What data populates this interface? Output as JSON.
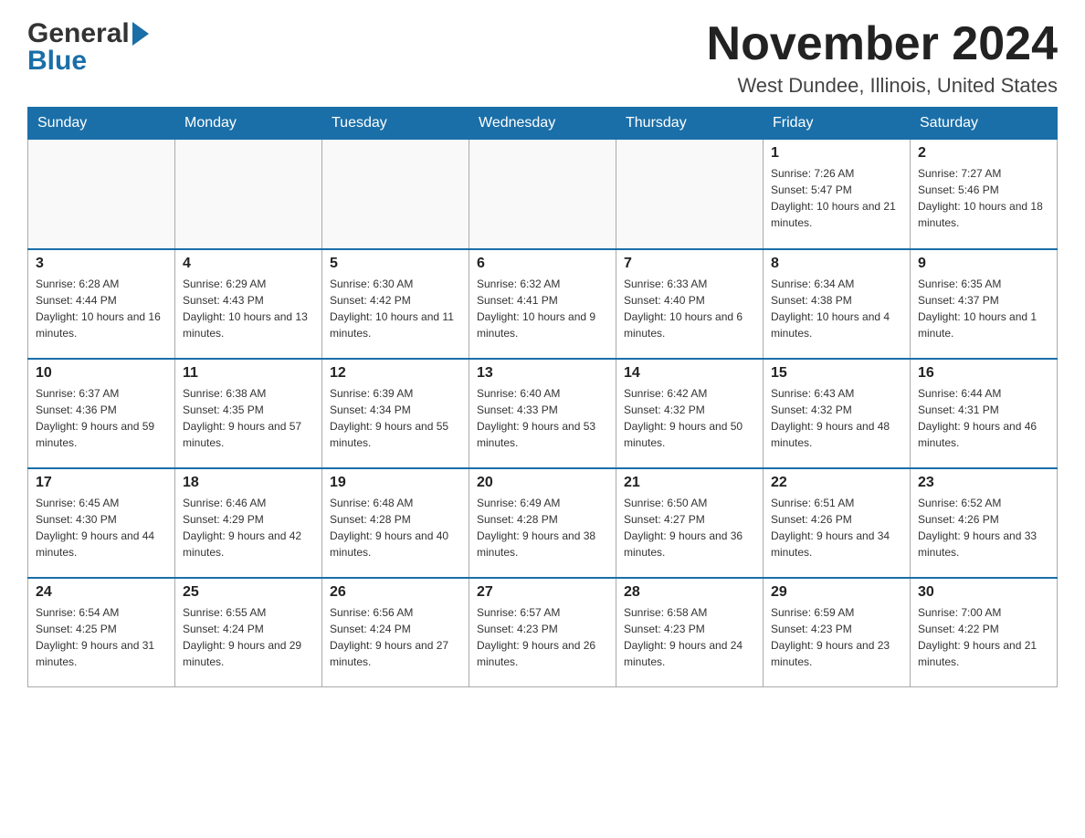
{
  "header": {
    "logo_general": "General",
    "logo_blue": "Blue",
    "month_title": "November 2024",
    "location": "West Dundee, Illinois, United States"
  },
  "weekdays": [
    "Sunday",
    "Monday",
    "Tuesday",
    "Wednesday",
    "Thursday",
    "Friday",
    "Saturday"
  ],
  "weeks": [
    [
      {
        "day": "",
        "sunrise": "",
        "sunset": "",
        "daylight": ""
      },
      {
        "day": "",
        "sunrise": "",
        "sunset": "",
        "daylight": ""
      },
      {
        "day": "",
        "sunrise": "",
        "sunset": "",
        "daylight": ""
      },
      {
        "day": "",
        "sunrise": "",
        "sunset": "",
        "daylight": ""
      },
      {
        "day": "",
        "sunrise": "",
        "sunset": "",
        "daylight": ""
      },
      {
        "day": "1",
        "sunrise": "Sunrise: 7:26 AM",
        "sunset": "Sunset: 5:47 PM",
        "daylight": "Daylight: 10 hours and 21 minutes."
      },
      {
        "day": "2",
        "sunrise": "Sunrise: 7:27 AM",
        "sunset": "Sunset: 5:46 PM",
        "daylight": "Daylight: 10 hours and 18 minutes."
      }
    ],
    [
      {
        "day": "3",
        "sunrise": "Sunrise: 6:28 AM",
        "sunset": "Sunset: 4:44 PM",
        "daylight": "Daylight: 10 hours and 16 minutes."
      },
      {
        "day": "4",
        "sunrise": "Sunrise: 6:29 AM",
        "sunset": "Sunset: 4:43 PM",
        "daylight": "Daylight: 10 hours and 13 minutes."
      },
      {
        "day": "5",
        "sunrise": "Sunrise: 6:30 AM",
        "sunset": "Sunset: 4:42 PM",
        "daylight": "Daylight: 10 hours and 11 minutes."
      },
      {
        "day": "6",
        "sunrise": "Sunrise: 6:32 AM",
        "sunset": "Sunset: 4:41 PM",
        "daylight": "Daylight: 10 hours and 9 minutes."
      },
      {
        "day": "7",
        "sunrise": "Sunrise: 6:33 AM",
        "sunset": "Sunset: 4:40 PM",
        "daylight": "Daylight: 10 hours and 6 minutes."
      },
      {
        "day": "8",
        "sunrise": "Sunrise: 6:34 AM",
        "sunset": "Sunset: 4:38 PM",
        "daylight": "Daylight: 10 hours and 4 minutes."
      },
      {
        "day": "9",
        "sunrise": "Sunrise: 6:35 AM",
        "sunset": "Sunset: 4:37 PM",
        "daylight": "Daylight: 10 hours and 1 minute."
      }
    ],
    [
      {
        "day": "10",
        "sunrise": "Sunrise: 6:37 AM",
        "sunset": "Sunset: 4:36 PM",
        "daylight": "Daylight: 9 hours and 59 minutes."
      },
      {
        "day": "11",
        "sunrise": "Sunrise: 6:38 AM",
        "sunset": "Sunset: 4:35 PM",
        "daylight": "Daylight: 9 hours and 57 minutes."
      },
      {
        "day": "12",
        "sunrise": "Sunrise: 6:39 AM",
        "sunset": "Sunset: 4:34 PM",
        "daylight": "Daylight: 9 hours and 55 minutes."
      },
      {
        "day": "13",
        "sunrise": "Sunrise: 6:40 AM",
        "sunset": "Sunset: 4:33 PM",
        "daylight": "Daylight: 9 hours and 53 minutes."
      },
      {
        "day": "14",
        "sunrise": "Sunrise: 6:42 AM",
        "sunset": "Sunset: 4:32 PM",
        "daylight": "Daylight: 9 hours and 50 minutes."
      },
      {
        "day": "15",
        "sunrise": "Sunrise: 6:43 AM",
        "sunset": "Sunset: 4:32 PM",
        "daylight": "Daylight: 9 hours and 48 minutes."
      },
      {
        "day": "16",
        "sunrise": "Sunrise: 6:44 AM",
        "sunset": "Sunset: 4:31 PM",
        "daylight": "Daylight: 9 hours and 46 minutes."
      }
    ],
    [
      {
        "day": "17",
        "sunrise": "Sunrise: 6:45 AM",
        "sunset": "Sunset: 4:30 PM",
        "daylight": "Daylight: 9 hours and 44 minutes."
      },
      {
        "day": "18",
        "sunrise": "Sunrise: 6:46 AM",
        "sunset": "Sunset: 4:29 PM",
        "daylight": "Daylight: 9 hours and 42 minutes."
      },
      {
        "day": "19",
        "sunrise": "Sunrise: 6:48 AM",
        "sunset": "Sunset: 4:28 PM",
        "daylight": "Daylight: 9 hours and 40 minutes."
      },
      {
        "day": "20",
        "sunrise": "Sunrise: 6:49 AM",
        "sunset": "Sunset: 4:28 PM",
        "daylight": "Daylight: 9 hours and 38 minutes."
      },
      {
        "day": "21",
        "sunrise": "Sunrise: 6:50 AM",
        "sunset": "Sunset: 4:27 PM",
        "daylight": "Daylight: 9 hours and 36 minutes."
      },
      {
        "day": "22",
        "sunrise": "Sunrise: 6:51 AM",
        "sunset": "Sunset: 4:26 PM",
        "daylight": "Daylight: 9 hours and 34 minutes."
      },
      {
        "day": "23",
        "sunrise": "Sunrise: 6:52 AM",
        "sunset": "Sunset: 4:26 PM",
        "daylight": "Daylight: 9 hours and 33 minutes."
      }
    ],
    [
      {
        "day": "24",
        "sunrise": "Sunrise: 6:54 AM",
        "sunset": "Sunset: 4:25 PM",
        "daylight": "Daylight: 9 hours and 31 minutes."
      },
      {
        "day": "25",
        "sunrise": "Sunrise: 6:55 AM",
        "sunset": "Sunset: 4:24 PM",
        "daylight": "Daylight: 9 hours and 29 minutes."
      },
      {
        "day": "26",
        "sunrise": "Sunrise: 6:56 AM",
        "sunset": "Sunset: 4:24 PM",
        "daylight": "Daylight: 9 hours and 27 minutes."
      },
      {
        "day": "27",
        "sunrise": "Sunrise: 6:57 AM",
        "sunset": "Sunset: 4:23 PM",
        "daylight": "Daylight: 9 hours and 26 minutes."
      },
      {
        "day": "28",
        "sunrise": "Sunrise: 6:58 AM",
        "sunset": "Sunset: 4:23 PM",
        "daylight": "Daylight: 9 hours and 24 minutes."
      },
      {
        "day": "29",
        "sunrise": "Sunrise: 6:59 AM",
        "sunset": "Sunset: 4:23 PM",
        "daylight": "Daylight: 9 hours and 23 minutes."
      },
      {
        "day": "30",
        "sunrise": "Sunrise: 7:00 AM",
        "sunset": "Sunset: 4:22 PM",
        "daylight": "Daylight: 9 hours and 21 minutes."
      }
    ]
  ]
}
